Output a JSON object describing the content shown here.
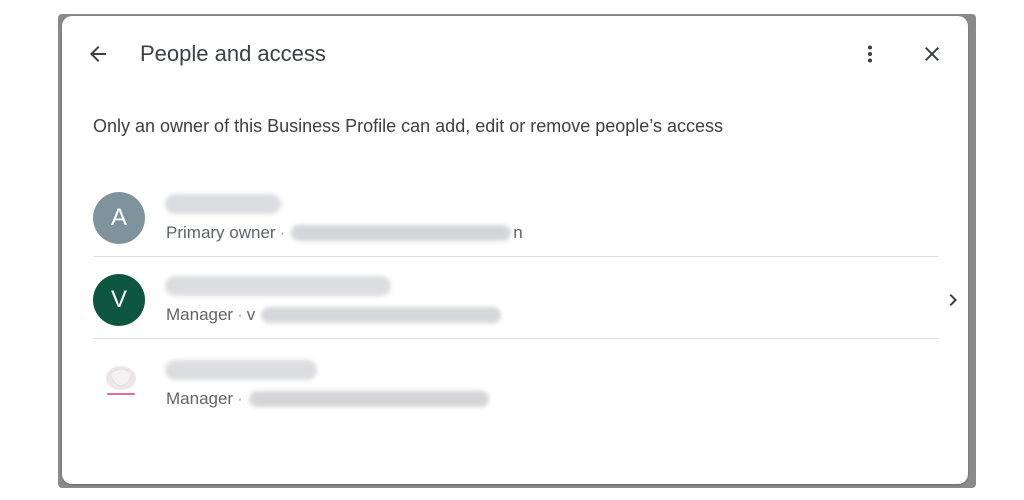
{
  "dialog": {
    "title": "People and access",
    "notice": "Only an owner of this Business Profile can add, edit or remove people’s access",
    "icons": {
      "back": "arrow-back-icon",
      "more": "more-vertical-icon",
      "close": "close-icon",
      "chevron": "chevron-right-icon"
    }
  },
  "people": [
    {
      "avatar_letter": "A",
      "avatar_color": "#7f939c",
      "role": "Primary owner",
      "separator": "·",
      "email_tail": "n"
    },
    {
      "avatar_letter": "V",
      "avatar_color": "#0f5640",
      "role": "Manager",
      "separator": "·",
      "email_head": "v"
    },
    {
      "avatar_logo": "logo-avatar",
      "role": "Manager",
      "separator": "·"
    }
  ],
  "colors": {
    "text_primary": "#3c4043",
    "text_secondary": "#5f6368",
    "divider": "#e0e0e0"
  }
}
